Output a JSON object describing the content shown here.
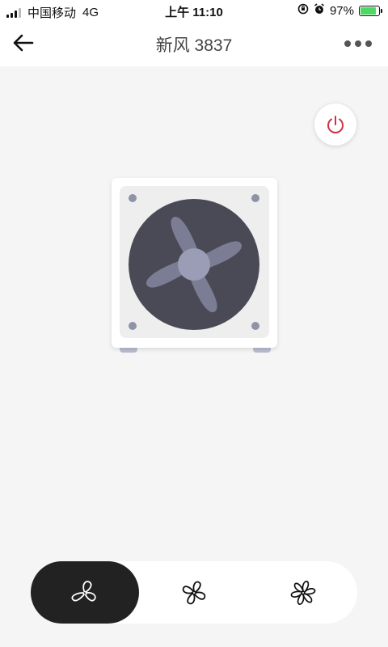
{
  "status_bar": {
    "carrier": "中国移动",
    "network": "4G",
    "time": "上午 11:10",
    "battery_percent": "97%",
    "battery_level": 0.97
  },
  "header": {
    "title": "新风 3837",
    "back_icon": "arrow-left-icon",
    "more_icon": "more-dots-icon"
  },
  "power": {
    "icon": "power-icon",
    "color": "#d0314a"
  },
  "fan_illustration": {
    "icon": "fan-unit-icon",
    "colors": {
      "disc": "#4a4a57",
      "blades": "#7a7d93",
      "hub": "#9a9db5",
      "screws": "#8f93a6"
    }
  },
  "modes": {
    "selected_index": 0,
    "items": [
      {
        "icon": "fan-low-speed-icon"
      },
      {
        "icon": "fan-medium-speed-icon"
      },
      {
        "icon": "fan-high-speed-icon"
      }
    ]
  }
}
